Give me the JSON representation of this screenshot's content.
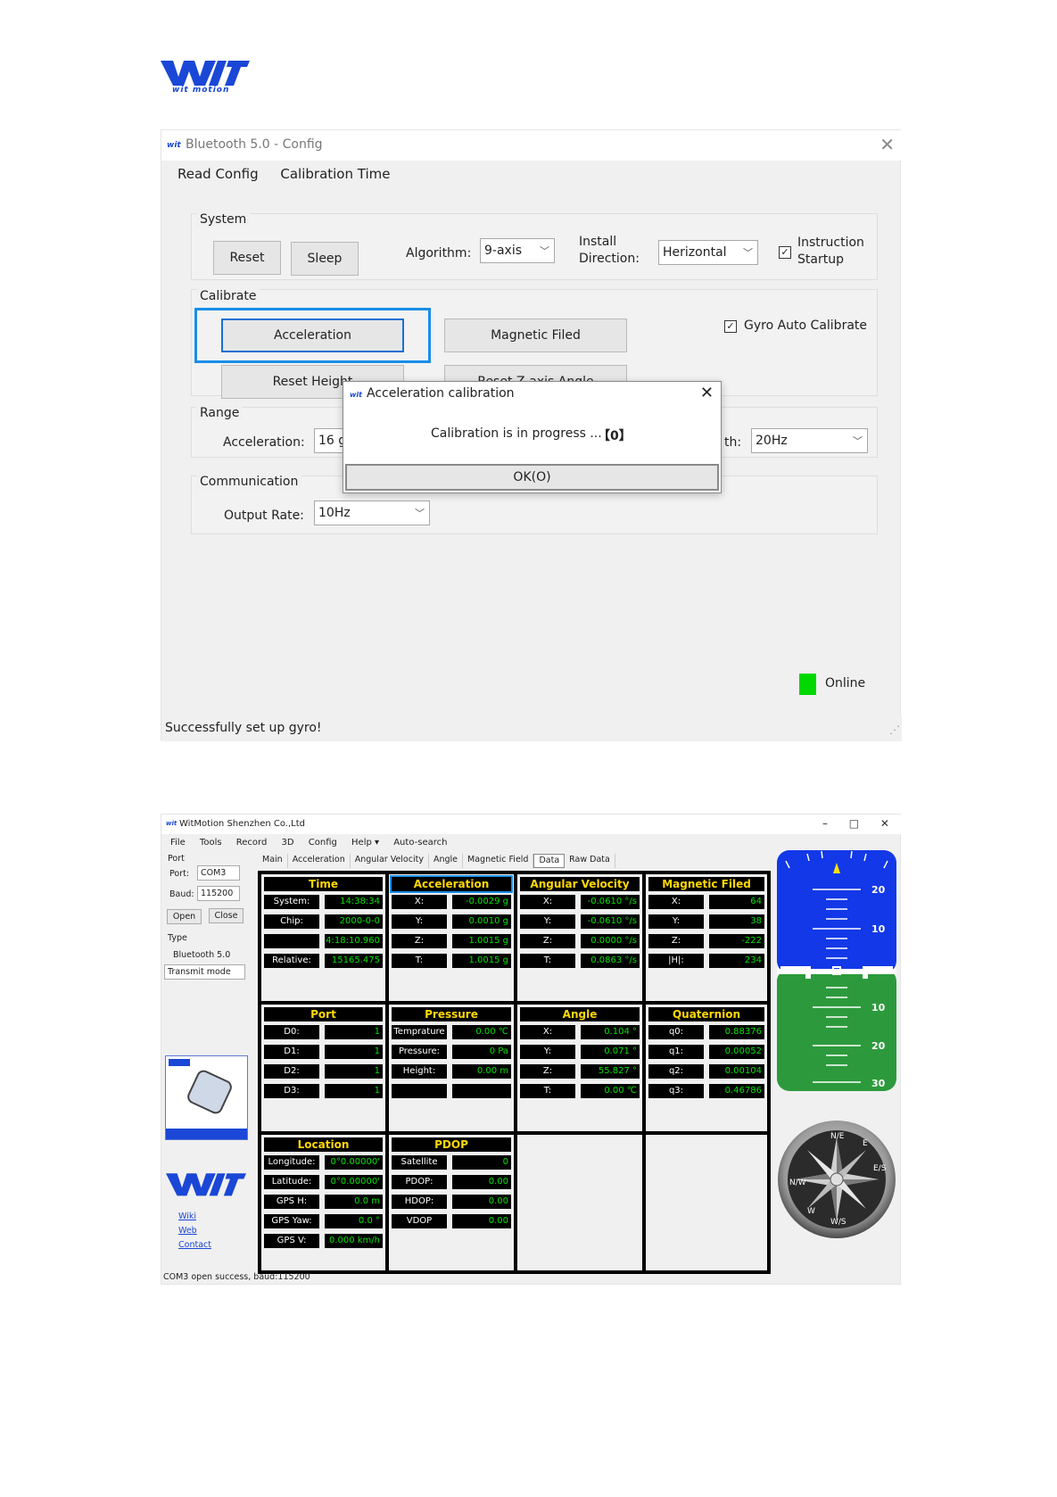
{
  "brand": {
    "logo_text": "WIT",
    "tagline": "wit motion"
  },
  "config_window": {
    "title": "Bluetooth 5.0 - Config",
    "menu": [
      "Read Config",
      "Calibration Time"
    ],
    "system": {
      "label": "System",
      "reset": "Reset",
      "sleep": "Sleep",
      "algorithm_label": "Algorithm:",
      "algorithm_value": "9-axis",
      "install_label_1": "Install",
      "install_label_2": "Direction:",
      "install_value": "Herizontal",
      "instruction_label_1": "Instruction",
      "instruction_label_2": "Startup",
      "instruction_checked": true
    },
    "calibrate": {
      "label": "Calibrate",
      "acceleration": "Acceleration",
      "magnetic": "Magnetic Filed",
      "reset_height": "Reset Height",
      "reset_z": "Reset Z-axis Angle",
      "gyro_label": "Gyro Auto Calibrate",
      "gyro_checked": true
    },
    "range": {
      "label": "Range",
      "acc_label": "Acceleration:",
      "acc_value": "16 g",
      "bw_label": "th:",
      "bw_value": "20Hz"
    },
    "communication": {
      "label": "Communication",
      "rate_label": "Output Rate:",
      "rate_value": "10Hz"
    },
    "online": "Online",
    "online_color": "#00d800",
    "status": "Successfully set up gyro!"
  },
  "dialog": {
    "title": "Acceleration calibration",
    "message": "Calibration is in progress ...",
    "counter": "【0】",
    "ok_label": "OK(O)"
  },
  "main_window": {
    "title": "WitMotion Shenzhen Co.,Ltd",
    "controls": "– □ ✕",
    "menu": [
      "File",
      "Tools",
      "Record",
      "3D",
      "Config",
      "Help ▾",
      "Auto-search"
    ],
    "tabs": [
      "Main",
      "Acceleration",
      "Angular Velocity",
      "Angle",
      "Magnetic Field",
      "Data",
      "Raw Data"
    ],
    "active_tab": "Data",
    "port_section": "Port",
    "port_label": "Port:",
    "port_value": "COM3",
    "baud_label": "Baud:",
    "baud_value": "115200",
    "open": "Open",
    "close": "Close",
    "type_section": "Type",
    "type_value": "Bluetooth 5.0",
    "mode_value": "Transmit mode",
    "links": [
      "Wiki",
      "Web",
      "Contact"
    ],
    "status": "COM3 open success, baud:115200",
    "panels": {
      "time": {
        "title": "Time",
        "rows": [
          [
            "System:",
            "14:38:34"
          ],
          [
            "Chip:",
            "2000-0-0"
          ],
          [
            "",
            "4:18:10.960"
          ],
          [
            "Relative:",
            "15165.475"
          ]
        ]
      },
      "acceleration": {
        "title": "Acceleration",
        "rows": [
          [
            "X:",
            "-0.0029 g"
          ],
          [
            "Y:",
            "0.0010 g"
          ],
          [
            "Z:",
            "1.0015 g"
          ],
          [
            "T:",
            "1.0015 g"
          ]
        ]
      },
      "angular": {
        "title": "Angular Velocity",
        "rows": [
          [
            "X:",
            "-0.0610 °/s"
          ],
          [
            "Y:",
            "-0.0610 °/s"
          ],
          [
            "Z:",
            "0.0000 °/s"
          ],
          [
            "T:",
            "0.0863 °/s"
          ]
        ]
      },
      "magnetic": {
        "title": "Magnetic Filed",
        "rows": [
          [
            "X:",
            "64"
          ],
          [
            "Y:",
            "38"
          ],
          [
            "Z:",
            "-222"
          ],
          [
            "|H|:",
            "234"
          ]
        ]
      },
      "port": {
        "title": "Port",
        "rows": [
          [
            "D0:",
            "1"
          ],
          [
            "D1:",
            "1"
          ],
          [
            "D2:",
            "1"
          ],
          [
            "D3:",
            "1"
          ]
        ]
      },
      "pressure": {
        "title": "Pressure",
        "rows": [
          [
            "Temprature",
            "0.00 ℃"
          ],
          [
            "Pressure:",
            "0 Pa"
          ],
          [
            "Height:",
            "0.00 m"
          ],
          [
            "",
            ""
          ]
        ]
      },
      "angle": {
        "title": "Angle",
        "rows": [
          [
            "X:",
            "0.104 °"
          ],
          [
            "Y:",
            "0.071 °"
          ],
          [
            "Z:",
            "55.827 °"
          ],
          [
            "T:",
            "0.00 ℃"
          ]
        ]
      },
      "quaternion": {
        "title": "Quaternion",
        "rows": [
          [
            "q0:",
            "0.88376"
          ],
          [
            "q1:",
            "0.00052"
          ],
          [
            "q2:",
            "0.00104"
          ],
          [
            "q3:",
            "0.46786"
          ]
        ]
      },
      "location": {
        "title": "Location",
        "rows": [
          [
            "Longitude:",
            "0°0.00000'"
          ],
          [
            "Latitude:",
            "0°0.00000'"
          ],
          [
            "GPS H:",
            "0.0 m"
          ],
          [
            "GPS Yaw:",
            "0.0 °"
          ],
          [
            "GPS V:",
            "0.000 km/h"
          ]
        ]
      },
      "pdop": {
        "title": "PDOP",
        "rows": [
          [
            "Satellite",
            "0"
          ],
          [
            "PDOP:",
            "0.00"
          ],
          [
            "HDOP:",
            "0.00"
          ],
          [
            "VDOP",
            "0.00"
          ]
        ]
      }
    },
    "attitude_labels": [
      "20",
      "10",
      "10",
      "20",
      "30"
    ],
    "compass_labels": [
      "N/E",
      "E",
      "E/S",
      "W/S",
      "W",
      "N/W"
    ],
    "colors": {
      "sky": "#1238e8",
      "ground": "#2c9a3c",
      "value_green": "#00e100",
      "header_yellow": "#ffd800"
    }
  }
}
